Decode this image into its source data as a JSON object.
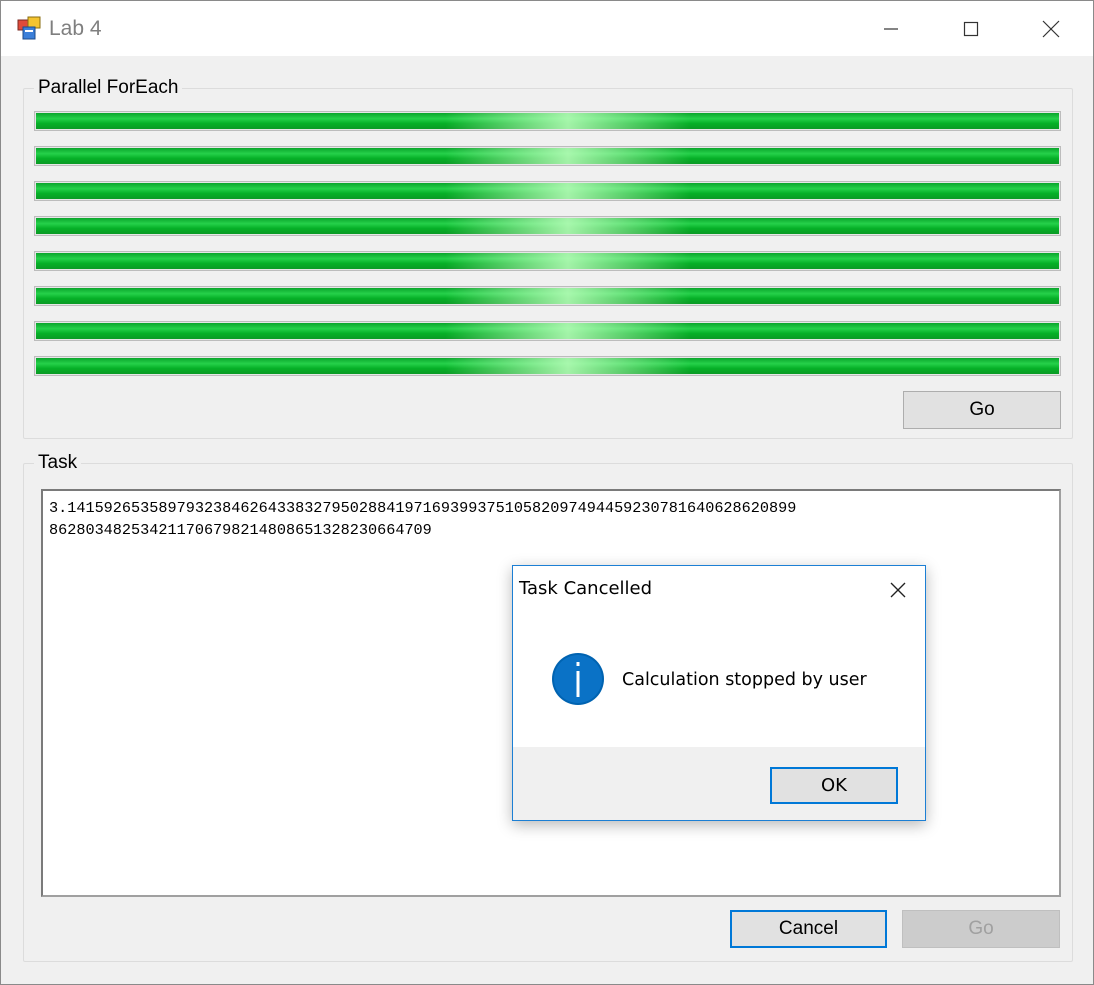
{
  "window": {
    "title": "Lab 4",
    "icons": {
      "app": "app-icon",
      "minimize": "minimize-icon",
      "maximize": "maximize-icon",
      "close": "close-icon"
    }
  },
  "parallel_group": {
    "title": "Parallel ForEach",
    "progress_bars": [
      {
        "value": 100
      },
      {
        "value": 100
      },
      {
        "value": 100
      },
      {
        "value": 100
      },
      {
        "value": 100
      },
      {
        "value": 100
      },
      {
        "value": 100
      },
      {
        "value": 100
      }
    ],
    "go_label": "Go"
  },
  "task_group": {
    "title": "Task",
    "output_text": "3.14159265358979323846264338327950288419716939937510582097494459230781640628620899\n862803482534211706798214808651328230664709",
    "cancel_label": "Cancel",
    "go_label": "Go",
    "go_disabled": true
  },
  "dialog": {
    "title": "Task Cancelled",
    "message": "Calculation stopped by user",
    "ok_label": "OK",
    "icon": "info-icon"
  },
  "colors": {
    "progress_fill": "#06b027",
    "focus_border": "#0078d7",
    "info_icon": "#0063b1"
  }
}
